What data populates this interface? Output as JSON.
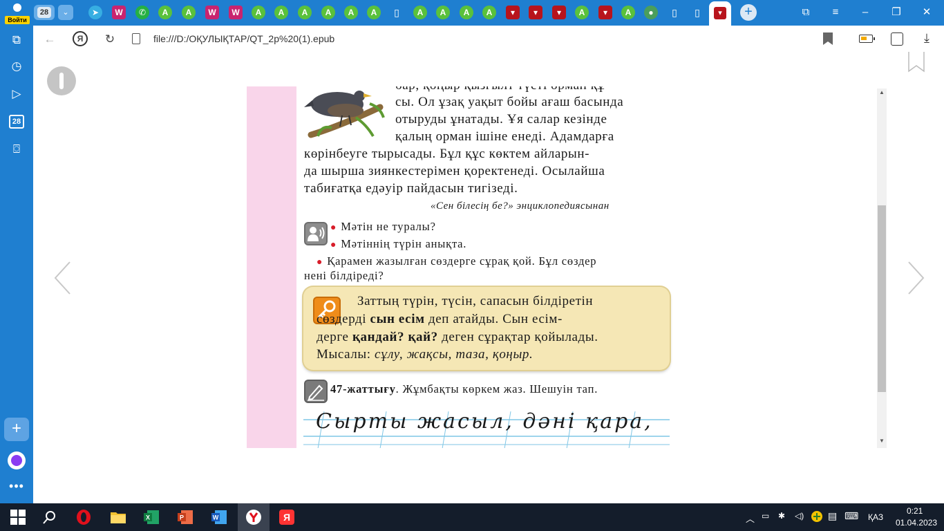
{
  "browser": {
    "profile_label": "Войти",
    "tab_count": "28",
    "address_url": "file:///D:/ОҚУЛЫҚТАР/QT_2р%20(1).epub"
  },
  "sidebar": {
    "calendar_day": "28"
  },
  "page": {
    "paragraph_lines": [
      "бар, қоңыр қызғылт түсті орман құ-",
      "сы. Ол ұзақ уақыт бойы ағаш басында",
      "отыруды ұнатады. Ұя салар кезінде",
      "қалың орман ішіне енеді. Адамдарға",
      "көрінбеуге тырысады. Бұл құс көктем айларын-",
      "да шырша зиянкестерімен қоректенеді. Осылайша",
      "табиғатқа едәуір пайдасын тигізеді."
    ],
    "source": "«Сен білесің бе?» энциклопедиясынан",
    "questions": [
      "Мәтін не туралы?",
      "Мәтіннің түрін анықта."
    ],
    "task_line1": "Қарамен жазылған сөздерге сұрақ қой. Бұл сөздер",
    "task_line2": "нені білдіреді?",
    "rule": {
      "line1": "Заттың түрін, түсін, сапасын білдіретін",
      "line2_a": "сөздерді ",
      "line2_b": "сын есім",
      "line2_c": " деп атайды. Сын есім-",
      "line3_a": "дерге ",
      "line3_b": "қандай? қай?",
      "line3_c": " деген сұрақтар қойылады.",
      "line4_a": "Мысалы: ",
      "line4_b": "сұлу, жақсы, таза, қоңыр."
    },
    "exercise_number": "47-жаттығу",
    "exercise_text": ". Жұмбақты көркем жаз. Шешуін тап.",
    "handwriting": "Сырты жасыл, дәні қара,"
  },
  "taskbar": {
    "lang": "ҚАЗ",
    "time": "0:21",
    "date": "01.04.2023"
  },
  "colors": {
    "browser_blue": "#1f7fd0",
    "margin_pink": "#f9d5ea",
    "rule_box": "#f5e7b5",
    "bullet_red": "#d81d2a"
  }
}
